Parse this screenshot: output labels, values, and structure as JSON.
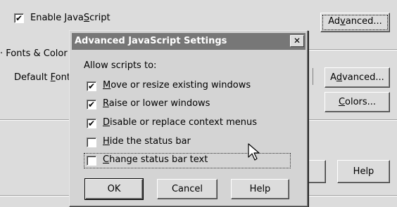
{
  "background": {
    "enable_js": {
      "label": "Enable JavaScript",
      "checked": true
    },
    "advanced_js_button": "Advanced...",
    "fonts_colors_group": "Fonts & Colors",
    "default_font_label": "Default Font",
    "advanced_font_button": "Advanced...",
    "colors_button": "Colors...",
    "help_button": "Help"
  },
  "dialog": {
    "title": "Advanced JavaScript Settings",
    "close_icon": "close-icon",
    "intro": "Allow scripts to:",
    "options": [
      {
        "label": "Move or resize existing windows",
        "checked": true
      },
      {
        "label": "Raise or lower windows",
        "checked": true
      },
      {
        "label": "Disable or replace context menus",
        "checked": true
      },
      {
        "label": "Hide the status bar",
        "checked": false
      },
      {
        "label": "Change status bar text",
        "checked": false
      }
    ],
    "ok_button": "OK",
    "cancel_button": "Cancel",
    "help_button": "Help"
  },
  "cursor": "mouse-pointer-icon",
  "colors": {
    "window_bg": "#dcdcdc",
    "dialog_bg": "#d4d4d4",
    "titlebar": "#777777"
  }
}
